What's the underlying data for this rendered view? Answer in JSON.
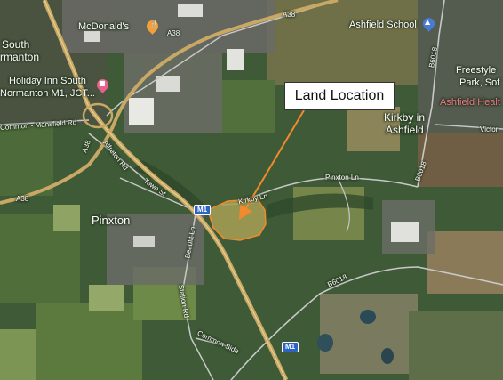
{
  "callout": {
    "text": "Land Location",
    "color": "#f08a2c"
  },
  "places": {
    "pinxton": "Pinxton",
    "kirkby_line1": "Kirkby in",
    "kirkby_line2": "Ashfield",
    "south_line1": "South",
    "south_line2": "rmanton"
  },
  "pois": {
    "mcdonalds": "McDonald's",
    "holiday_inn_line1": "Holiday Inn South",
    "holiday_inn_line2": "Normanton M1, JCT...",
    "ashfield_school": "Ashfield School",
    "freestyle_line1": "Freestyle",
    "freestyle_line2": "Park, Sof",
    "ashfield_health": "Ashfield Healt"
  },
  "roads": {
    "a38_top": "A38",
    "a38_mid": "A38",
    "a38_left": "A38",
    "a38_west": "A38",
    "mansfield_rd": "Common - Mansfield Rd",
    "alfreton_rd": "Alfreton Rd",
    "town_st": "Town St",
    "kirkby_ln": "Kirkby Ln",
    "pinxton_ln": "Pinxton Ln",
    "b6018_right": "B6018",
    "b6018_bottom": "B6018",
    "b6018_east": "B6018",
    "victoria": "Victor",
    "beaufit_ln": "Beaufit Ln",
    "station_rd": "Station Rd",
    "common_side": "Common Side",
    "m1_shield_top": "M1",
    "m1_shield_bottom": "M1"
  },
  "icons": {
    "mcdonalds": "restaurant-pin-icon",
    "holiday_inn": "hotel-pin-icon",
    "school": "school-pin-icon"
  },
  "colors": {
    "land_fill": "#a7a054",
    "land_outline": "#f08a2c",
    "motorway": "#c9a866",
    "minor_road": "#c8c8c8",
    "pin_orange": "#f0a13c",
    "pin_pink": "#e8618a",
    "pin_blue": "#4a7bd3"
  }
}
